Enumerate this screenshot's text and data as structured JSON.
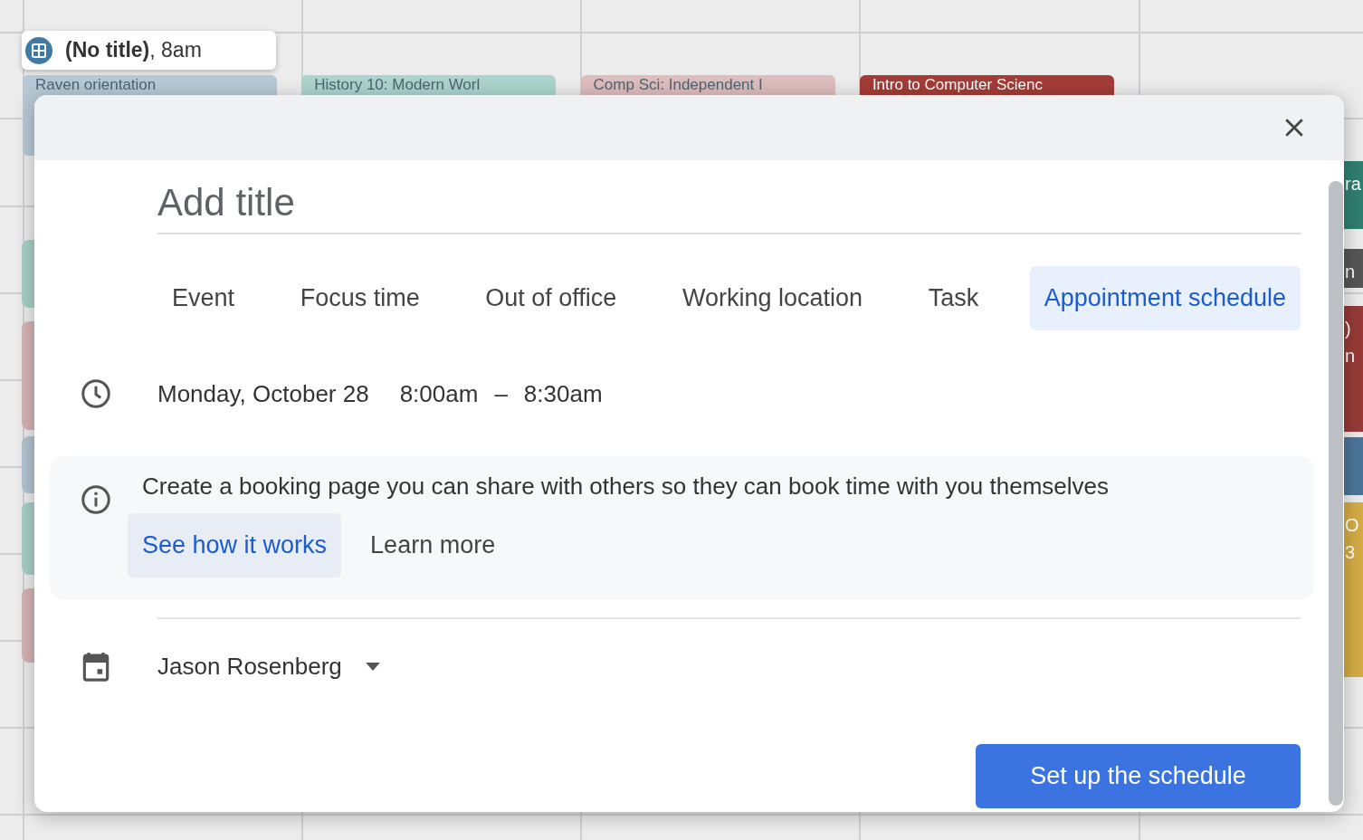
{
  "calendar": {
    "events": [
      {
        "title": "Raven orientation",
        "color": "#b7c9d6"
      },
      {
        "title": "History 10: Modern Worl",
        "color": "#abd4cd"
      },
      {
        "title": "Comp Sci: Independent I",
        "color": "#ddbdbd"
      },
      {
        "title": "Intro to Computer Scienc",
        "color": "#a33c37"
      }
    ],
    "left_events": [
      {
        "color": "#a7cfc7"
      },
      {
        "color": "#d4b3b3"
      },
      {
        "color": "#b2c4d1"
      },
      {
        "color": "#a7cfc7"
      },
      {
        "color": "#d4b3b3"
      }
    ],
    "right_events": [
      {
        "lines": [
          "ra"
        ],
        "color": "#2f7f6f"
      },
      {
        "lines": [
          "n"
        ],
        "color": "#565656"
      },
      {
        "lines": [
          ")",
          "n"
        ],
        "color": "#973a37"
      },
      {
        "color": "#4a7598"
      },
      {
        "lines": [
          "O",
          "3"
        ],
        "color": "#d4ab45"
      }
    ]
  },
  "new_event_chip": {
    "text": "**(No title)**, 8am"
  },
  "dialog": {
    "title_field": {
      "placeholder": "Add title"
    },
    "tabs": [
      {
        "label": "Event",
        "selected": false
      },
      {
        "label": "Focus time",
        "selected": false
      },
      {
        "label": "Out of office",
        "selected": false
      },
      {
        "label": "Working location",
        "selected": false
      },
      {
        "label": "Task",
        "selected": false
      },
      {
        "label": "Appointment schedule",
        "selected": true
      }
    ],
    "date": "Monday, October 28",
    "start_time": "8:00am",
    "separator": "–",
    "end_time": "8:30am",
    "info": {
      "text": "Create a booking page you can share with others so they can book time with you themselves",
      "buttons": [
        "See how it works",
        "Learn more"
      ]
    },
    "calendar_owner": "Jason Rosenberg",
    "primary_button": "Set up the schedule"
  }
}
